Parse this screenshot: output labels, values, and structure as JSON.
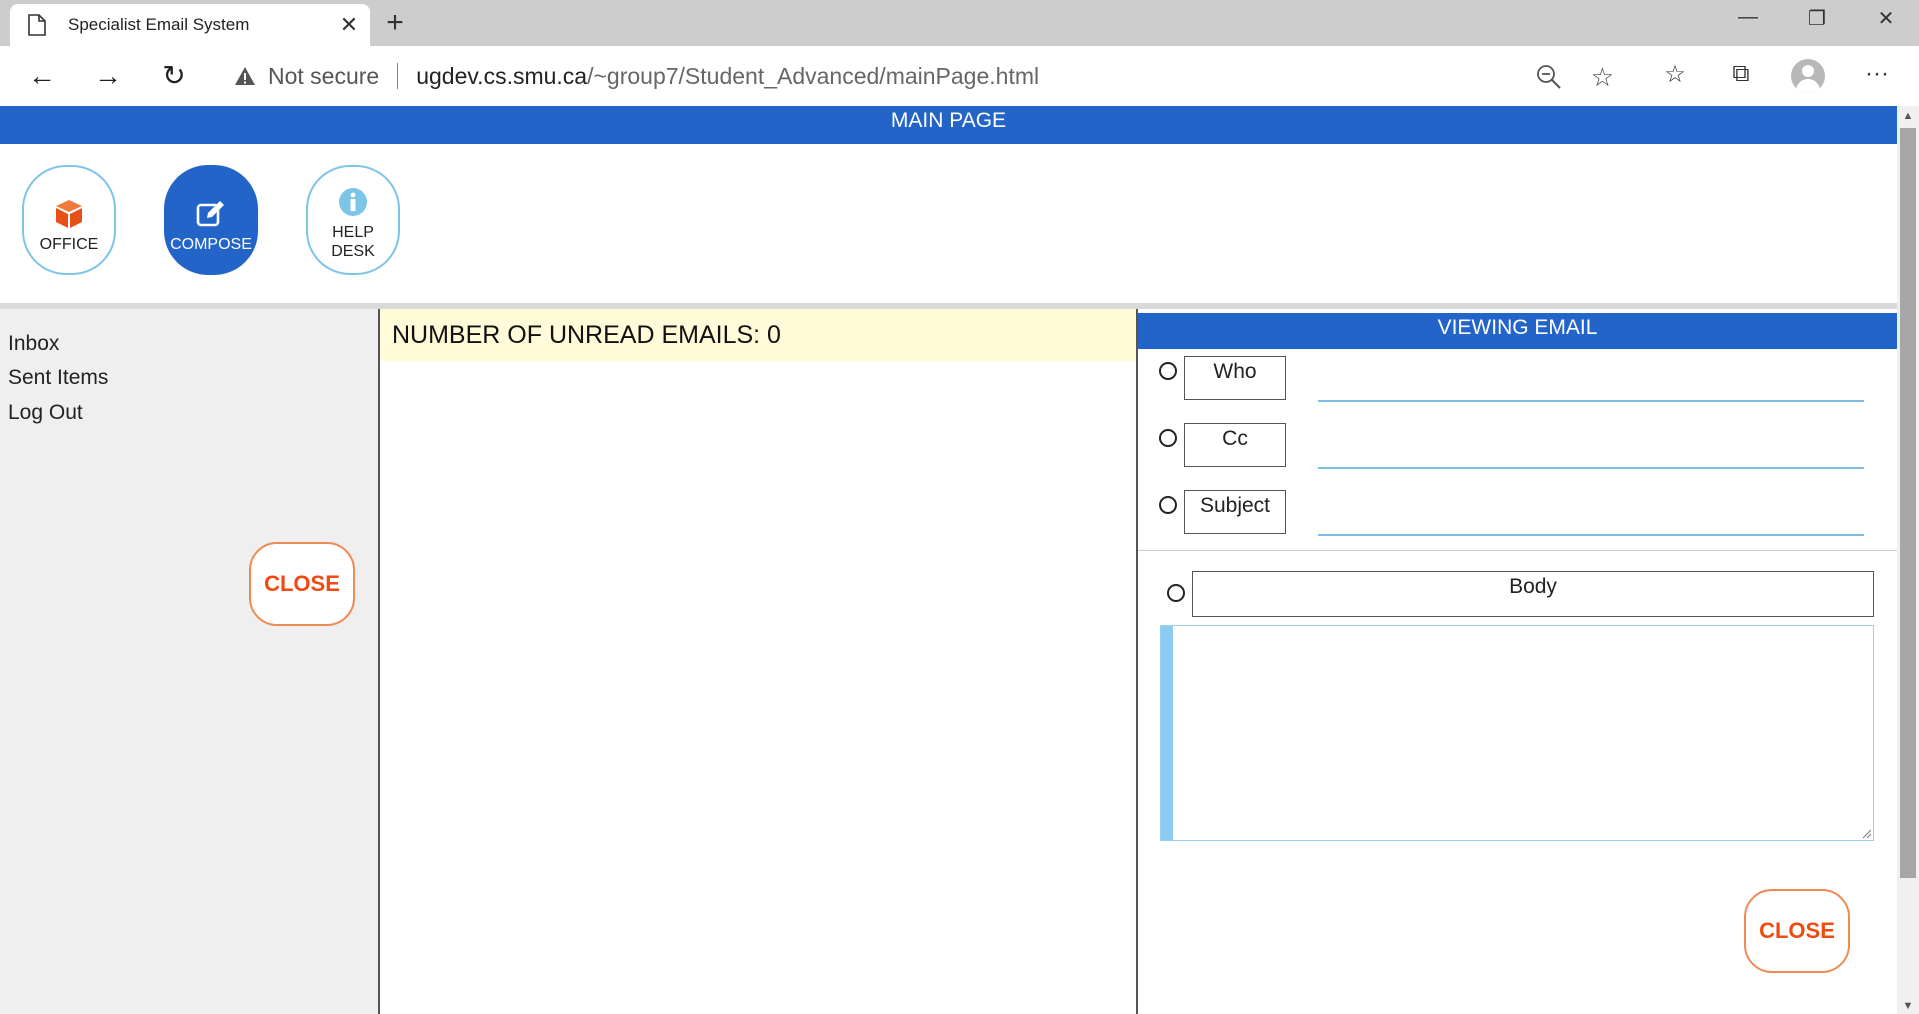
{
  "browser": {
    "tab_title": "Specialist Email System",
    "new_tab": "+",
    "security": "Not secure",
    "url_host": "ugdev.cs.smu.ca",
    "url_path": "/~group7/Student_Advanced/mainPage.html"
  },
  "header": {
    "title": "MAIN PAGE"
  },
  "toolbar": {
    "office_label": "OFFICE",
    "compose_label": "COMPOSE",
    "help_line1": "HELP",
    "help_line2": "DESK"
  },
  "sidebar": {
    "items": [
      {
        "label": "Inbox"
      },
      {
        "label": "Sent Items"
      },
      {
        "label": "Log Out"
      }
    ],
    "close_label": "CLOSE"
  },
  "list": {
    "unread_text": "NUMBER OF UNREAD EMAILS: 0"
  },
  "viewer": {
    "title": "VIEWING EMAIL",
    "who_label": "Who",
    "cc_label": "Cc",
    "subject_label": "Subject",
    "body_label": "Body",
    "close_label": "CLOSE"
  },
  "colors": {
    "header_blue": "#2264c8",
    "close_orange": "#ee4a12",
    "unread_bg": "#fffbd8"
  }
}
